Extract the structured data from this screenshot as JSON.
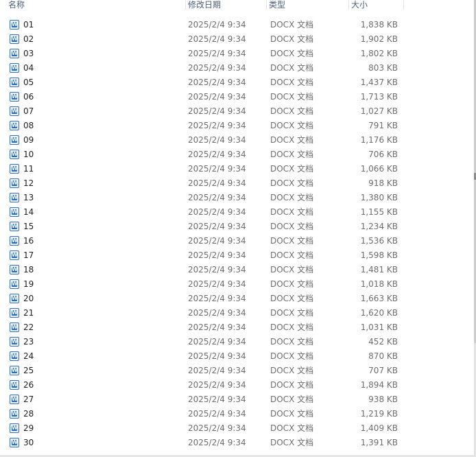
{
  "columns": {
    "name": "名称",
    "date": "修改日期",
    "type": "类型",
    "size": "大小"
  },
  "file_icon": "word-document-icon",
  "file_icon_glyph": "W",
  "files": [
    {
      "name": "01",
      "date": "2025/2/4 9:34",
      "type": "DOCX 文档",
      "size": "1,838 KB"
    },
    {
      "name": "02",
      "date": "2025/2/4 9:34",
      "type": "DOCX 文档",
      "size": "1,902 KB"
    },
    {
      "name": "03",
      "date": "2025/2/4 9:34",
      "type": "DOCX 文档",
      "size": "1,802 KB"
    },
    {
      "name": "04",
      "date": "2025/2/4 9:34",
      "type": "DOCX 文档",
      "size": "803 KB"
    },
    {
      "name": "05",
      "date": "2025/2/4 9:34",
      "type": "DOCX 文档",
      "size": "1,437 KB"
    },
    {
      "name": "06",
      "date": "2025/2/4 9:34",
      "type": "DOCX 文档",
      "size": "1,713 KB"
    },
    {
      "name": "07",
      "date": "2025/2/4 9:34",
      "type": "DOCX 文档",
      "size": "1,027 KB"
    },
    {
      "name": "08",
      "date": "2025/2/4 9:34",
      "type": "DOCX 文档",
      "size": "791 KB"
    },
    {
      "name": "09",
      "date": "2025/2/4 9:34",
      "type": "DOCX 文档",
      "size": "1,176 KB"
    },
    {
      "name": "10",
      "date": "2025/2/4 9:34",
      "type": "DOCX 文档",
      "size": "706 KB"
    },
    {
      "name": "11",
      "date": "2025/2/4 9:34",
      "type": "DOCX 文档",
      "size": "1,066 KB"
    },
    {
      "name": "12",
      "date": "2025/2/4 9:34",
      "type": "DOCX 文档",
      "size": "918 KB"
    },
    {
      "name": "13",
      "date": "2025/2/4 9:34",
      "type": "DOCX 文档",
      "size": "1,380 KB"
    },
    {
      "name": "14",
      "date": "2025/2/4 9:34",
      "type": "DOCX 文档",
      "size": "1,155 KB"
    },
    {
      "name": "15",
      "date": "2025/2/4 9:34",
      "type": "DOCX 文档",
      "size": "1,234 KB"
    },
    {
      "name": "16",
      "date": "2025/2/4 9:34",
      "type": "DOCX 文档",
      "size": "1,536 KB"
    },
    {
      "name": "17",
      "date": "2025/2/4 9:34",
      "type": "DOCX 文档",
      "size": "1,598 KB"
    },
    {
      "name": "18",
      "date": "2025/2/4 9:34",
      "type": "DOCX 文档",
      "size": "1,481 KB"
    },
    {
      "name": "19",
      "date": "2025/2/4 9:34",
      "type": "DOCX 文档",
      "size": "1,018 KB"
    },
    {
      "name": "20",
      "date": "2025/2/4 9:34",
      "type": "DOCX 文档",
      "size": "1,663 KB"
    },
    {
      "name": "21",
      "date": "2025/2/4 9:34",
      "type": "DOCX 文档",
      "size": "1,620 KB"
    },
    {
      "name": "22",
      "date": "2025/2/4 9:34",
      "type": "DOCX 文档",
      "size": "1,031 KB"
    },
    {
      "name": "23",
      "date": "2025/2/4 9:34",
      "type": "DOCX 文档",
      "size": "452 KB"
    },
    {
      "name": "24",
      "date": "2025/2/4 9:34",
      "type": "DOCX 文档",
      "size": "870 KB"
    },
    {
      "name": "25",
      "date": "2025/2/4 9:34",
      "type": "DOCX 文档",
      "size": "707 KB"
    },
    {
      "name": "26",
      "date": "2025/2/4 9:34",
      "type": "DOCX 文档",
      "size": "1,894 KB"
    },
    {
      "name": "27",
      "date": "2025/2/4 9:34",
      "type": "DOCX 文档",
      "size": "938 KB"
    },
    {
      "name": "28",
      "date": "2025/2/4 9:34",
      "type": "DOCX 文档",
      "size": "1,219 KB"
    },
    {
      "name": "29",
      "date": "2025/2/4 9:34",
      "type": "DOCX 文档",
      "size": "1,409 KB"
    },
    {
      "name": "30",
      "date": "2025/2/4 9:34",
      "type": "DOCX 文档",
      "size": "1,391 KB"
    }
  ],
  "colors": {
    "header_text": "#4c607a",
    "name_text": "#1e1e1e",
    "detail_text": "#6d6d6d",
    "icon_blue": "#1f6bd1"
  }
}
